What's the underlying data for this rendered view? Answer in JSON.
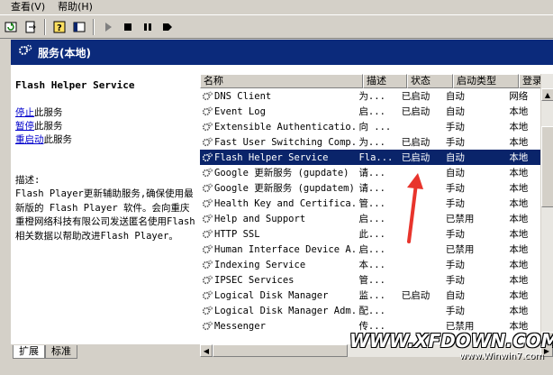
{
  "menu": {
    "view": "查看(V)",
    "help": "帮助(H)"
  },
  "toolbar": {
    "buttons": [
      "refresh-icon",
      "export-icon",
      "help-icon",
      "properties-icon",
      "play-icon",
      "stop-icon",
      "pause-icon",
      "restart-icon"
    ]
  },
  "header": {
    "title": "服务(本地)"
  },
  "detail": {
    "service_name": "Flash Helper Service",
    "stop_link": "停止",
    "stop_suffix": "此服务",
    "pause_link": "暂停",
    "pause_suffix": "此服务",
    "restart_link": "重启动",
    "restart_suffix": "此服务",
    "desc_label": "描述:",
    "desc_text": "Flash Player更新辅助服务,确保使用最新版的 Flash Player 软件。会向重庆重橙网络科技有限公司发送匿名使用Flash相关数据以帮助改进Flash Player。"
  },
  "tabs": {
    "extended": "扩展",
    "standard": "标准"
  },
  "columns": {
    "name": "名称",
    "description": "描述",
    "status": "状态",
    "startup": "启动类型",
    "logon": "登录为"
  },
  "rows": [
    {
      "name": "DNS Client",
      "desc": "为...",
      "status": "已启动",
      "startup": "自动",
      "logon": "网络"
    },
    {
      "name": "Event Log",
      "desc": "启...",
      "status": "已启动",
      "startup": "自动",
      "logon": "本地"
    },
    {
      "name": "Extensible Authenticatio...",
      "desc": "向 ...",
      "status": "",
      "startup": "手动",
      "logon": "本地"
    },
    {
      "name": "Fast User Switching Comp...",
      "desc": "为...",
      "status": "已启动",
      "startup": "手动",
      "logon": "本地"
    },
    {
      "name": "Flash Helper Service",
      "desc": "Fla...",
      "status": "已启动",
      "startup": "自动",
      "logon": "本地",
      "selected": true
    },
    {
      "name": "Google 更新服务 (gupdate)",
      "desc": "请...",
      "status": "",
      "startup": "自动",
      "logon": "本地"
    },
    {
      "name": "Google 更新服务 (gupdatem)",
      "desc": "请...",
      "status": "",
      "startup": "手动",
      "logon": "本地"
    },
    {
      "name": "Health Key and Certifica...",
      "desc": "管...",
      "status": "",
      "startup": "手动",
      "logon": "本地"
    },
    {
      "name": "Help and Support",
      "desc": "启...",
      "status": "",
      "startup": "已禁用",
      "logon": "本地"
    },
    {
      "name": "HTTP SSL",
      "desc": "此...",
      "status": "",
      "startup": "手动",
      "logon": "本地"
    },
    {
      "name": "Human Interface Device A...",
      "desc": "启...",
      "status": "",
      "startup": "已禁用",
      "logon": "本地"
    },
    {
      "name": "Indexing Service",
      "desc": "本...",
      "status": "",
      "startup": "手动",
      "logon": "本地"
    },
    {
      "name": "IPSEC Services",
      "desc": "管...",
      "status": "",
      "startup": "手动",
      "logon": "本地"
    },
    {
      "name": "Logical Disk Manager",
      "desc": "监...",
      "status": "已启动",
      "startup": "自动",
      "logon": "本地"
    },
    {
      "name": "Logical Disk Manager Adm...",
      "desc": "配...",
      "status": "",
      "startup": "手动",
      "logon": "本地"
    },
    {
      "name": "Messenger",
      "desc": "传...",
      "status": "",
      "startup": "已禁用",
      "logon": "本地"
    }
  ],
  "watermark": {
    "main": "WWW.XFDOWN.COM",
    "sub": "www.Winwin7.com"
  },
  "colors": {
    "header_bg": "#0b2a7b",
    "selection_bg": "#0a246a",
    "link": "#0000cc",
    "annotation_arrow": "#e8342c"
  }
}
